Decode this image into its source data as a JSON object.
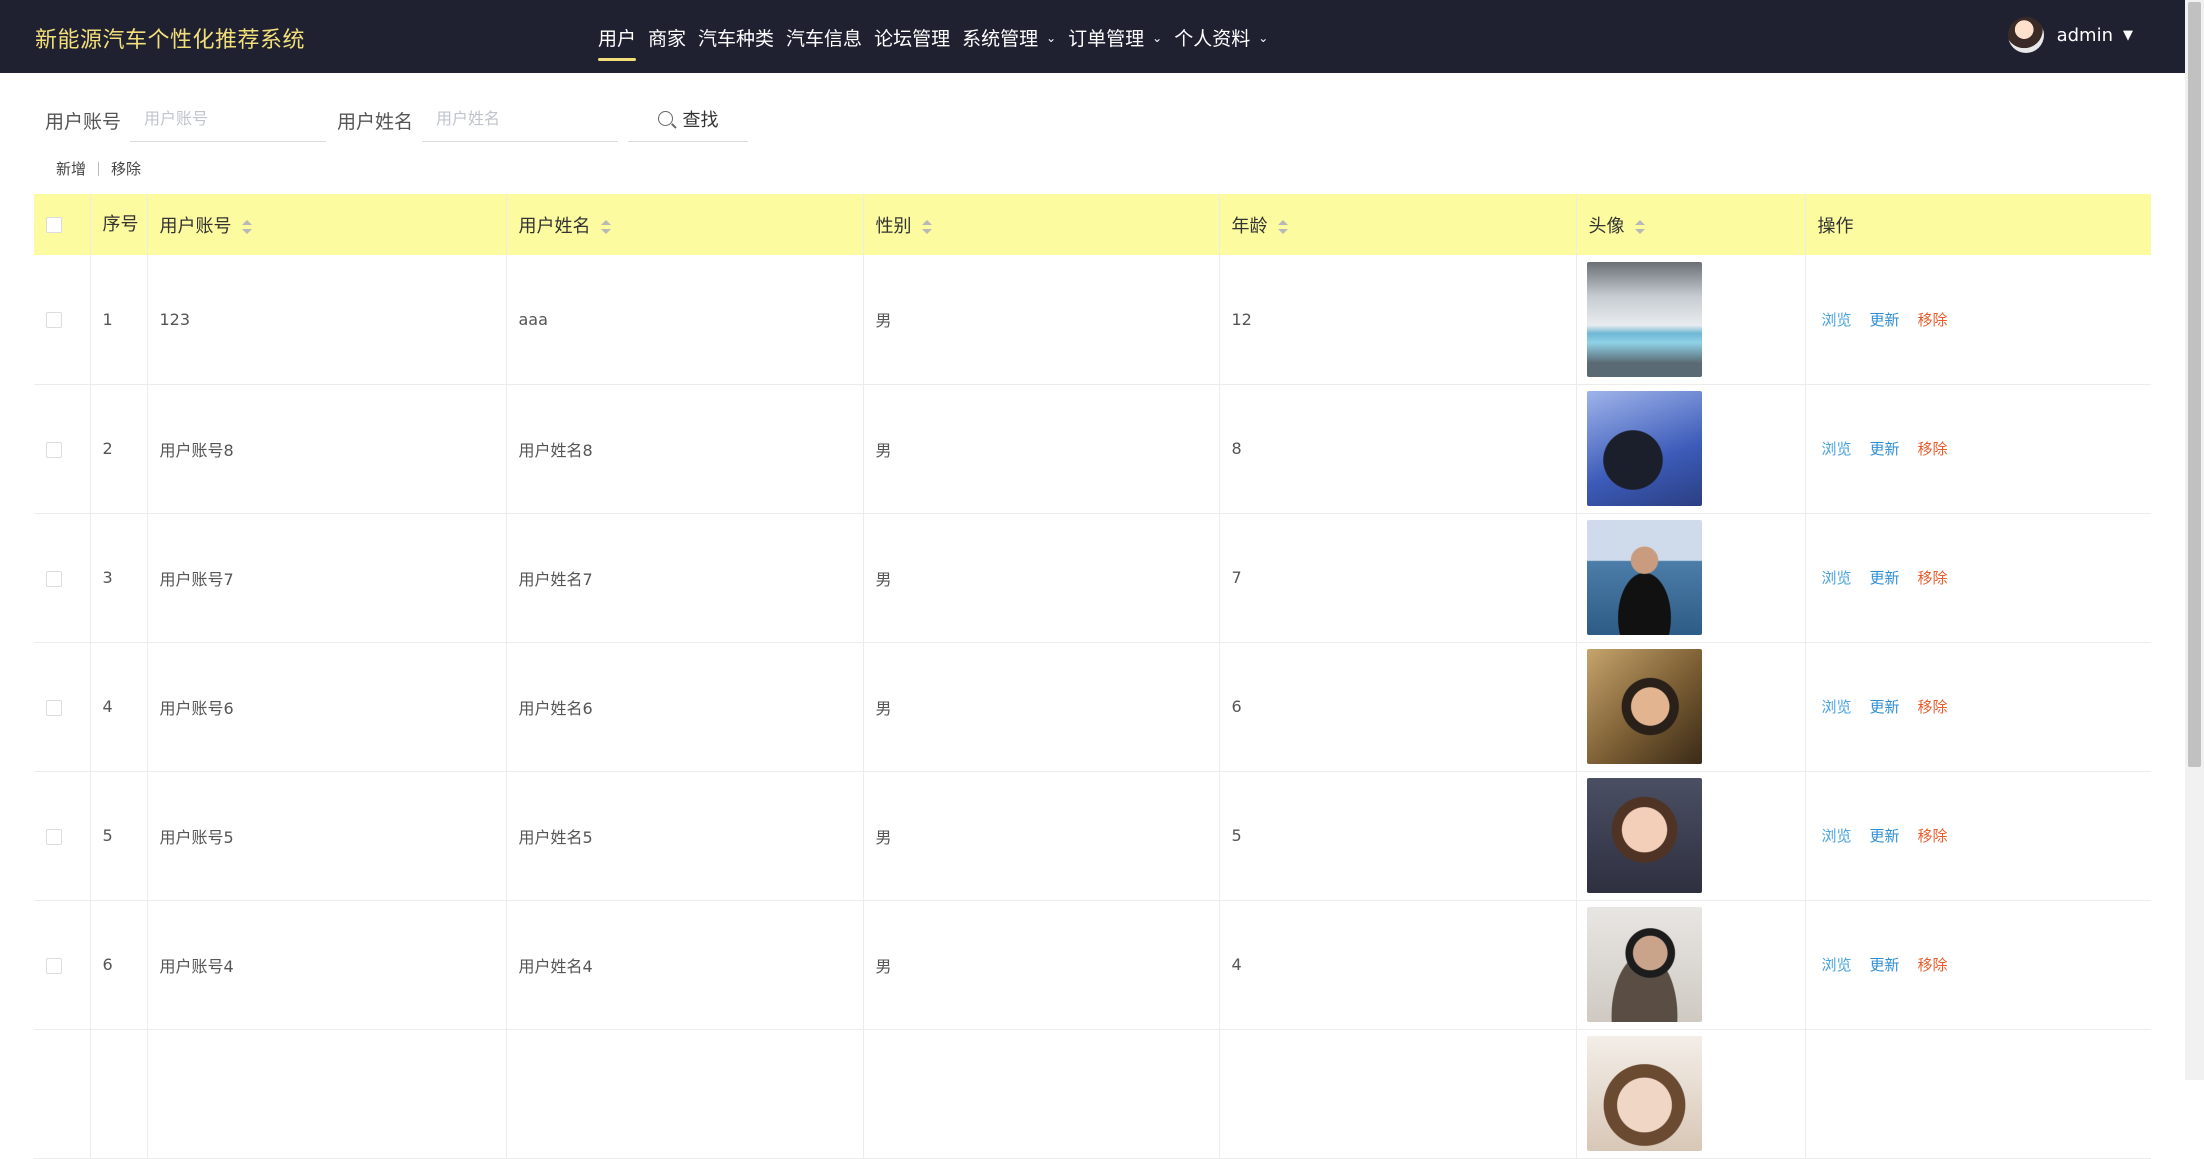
{
  "header": {
    "brand": "新能源汽车个性化推荐系统",
    "nav": [
      {
        "label": "用户",
        "active": true,
        "dropdown": false
      },
      {
        "label": "商家",
        "active": false,
        "dropdown": false
      },
      {
        "label": "汽车种类",
        "active": false,
        "dropdown": false
      },
      {
        "label": "汽车信息",
        "active": false,
        "dropdown": false
      },
      {
        "label": "论坛管理",
        "active": false,
        "dropdown": false
      },
      {
        "label": "系统管理",
        "active": false,
        "dropdown": true
      },
      {
        "label": "订单管理",
        "active": false,
        "dropdown": true
      },
      {
        "label": "个人资料",
        "active": false,
        "dropdown": true
      }
    ],
    "user": {
      "name": "admin",
      "caret": "▼"
    },
    "colors": {
      "bar": "#1f2131",
      "brand": "#f3df7a"
    }
  },
  "search": {
    "account_label": "用户账号",
    "account_placeholder": "用户账号",
    "account_value": "",
    "name_label": "用户姓名",
    "name_placeholder": "用户姓名",
    "name_value": "",
    "button_label": "查找",
    "icon": "search-icon"
  },
  "actions": {
    "add_label": "新增",
    "remove_label": "移除"
  },
  "table": {
    "header_color": "#fdfb9f",
    "columns": {
      "seq": "序号",
      "account": "用户账号",
      "name": "用户姓名",
      "gender": "性别",
      "age": "年龄",
      "avatar": "头像",
      "ops": "操作"
    },
    "ops": {
      "view": "浏览",
      "update": "更新",
      "remove": "移除"
    },
    "rows": [
      {
        "seq": "1",
        "account": "123",
        "name": "aaa",
        "gender": "男",
        "age": "12",
        "avatar": "car-photo"
      },
      {
        "seq": "2",
        "account": "用户账号8",
        "name": "用户姓名8",
        "gender": "男",
        "age": "8",
        "avatar": "portrait-photo"
      },
      {
        "seq": "3",
        "account": "用户账号7",
        "name": "用户姓名7",
        "gender": "男",
        "age": "7",
        "avatar": "portrait-photo"
      },
      {
        "seq": "4",
        "account": "用户账号6",
        "name": "用户姓名6",
        "gender": "男",
        "age": "6",
        "avatar": "portrait-photo"
      },
      {
        "seq": "5",
        "account": "用户账号5",
        "name": "用户姓名5",
        "gender": "男",
        "age": "5",
        "avatar": "cartoon-photo"
      },
      {
        "seq": "6",
        "account": "用户账号4",
        "name": "用户姓名4",
        "gender": "男",
        "age": "4",
        "avatar": "portrait-photo"
      },
      {
        "seq": "",
        "account": "",
        "name": "",
        "gender": "",
        "age": "",
        "avatar": "portrait-photo"
      }
    ]
  }
}
